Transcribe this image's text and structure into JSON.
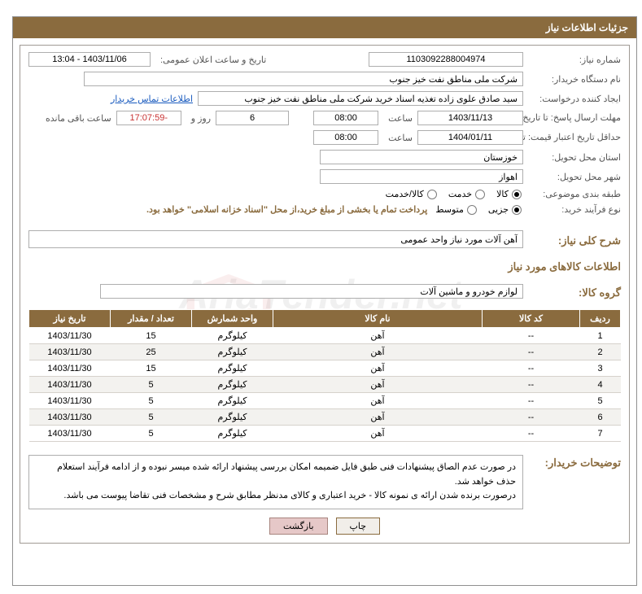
{
  "watermark": "AriaTender.net",
  "header": "جزئیات اطلاعات نیاز",
  "fields": {
    "need_number_label": "شماره نیاز:",
    "need_number": "1103092288004974",
    "announce_datetime_label": "تاریخ و ساعت اعلان عمومی:",
    "announce_datetime": "1403/11/06 - 13:04",
    "buyer_org_label": "نام دستگاه خریدار:",
    "buyer_org": "شرکت ملی مناطق نفت خیز جنوب",
    "requestor_label": "ایجاد کننده درخواست:",
    "requestor": "سید صادق علوی زاده  تغذیه اسناد خرید  شرکت ملی مناطق نفت خیز جنوب",
    "buyer_contact_link": "اطلاعات تماس خریدار",
    "response_deadline_label": "مهلت ارسال پاسخ: تا تاریخ:",
    "response_deadline_date": "1403/11/13",
    "hour_label": "ساعت",
    "response_deadline_time": "08:00",
    "days_remain": "6",
    "days_and": "روز و",
    "time_remain": "17:07:59-",
    "remain_suffix": "ساعت باقی مانده",
    "price_validity_label": "حداقل تاریخ اعتبار قیمت: تا تاریخ:",
    "price_validity_date": "1404/01/11",
    "price_validity_time": "08:00",
    "province_label": "استان محل تحویل:",
    "province": "خوزستان",
    "city_label": "شهر محل تحویل:",
    "city": "اهواز",
    "category_label": "طبقه بندی موضوعی:",
    "cat_goods": "کالا",
    "cat_services": "خدمت",
    "cat_goods_services": "کالا/خدمت",
    "purchase_type_label": "نوع فرآیند خرید:",
    "pt_partial": "جزیی",
    "pt_medium": "متوسط",
    "purchase_note": "پرداخت تمام یا بخشی از مبلغ خرید،از محل \"اسناد خزانه اسلامی\" خواهد بود.",
    "need_summary_label": "شرح کلی نیاز:",
    "need_summary": "آهن آلات مورد نیاز واحد عمومی",
    "items_section": "اطلاعات کالاهای مورد نیاز",
    "group_label": "گروه کالا:",
    "group_value": "لوازم خودرو و ماشین آلات",
    "buyer_notes_label": "توضیحات خریدار:",
    "buyer_notes_1": "در صورت عدم الصاق پیشنهادات فنی طبق فایل ضمیمه امکان بررسی پیشنهاد ارائه شده میسر نبوده و از ادامه فرآیند استعلام حذف خواهد شد.",
    "buyer_notes_2": "درصورت برنده شدن ارائه ی نمونه کالا - خرید اعتباری و کالای مدنظر مطابق شرح و مشخصات فنی تقاضا پیوست می باشد."
  },
  "table": {
    "headers": {
      "row": "ردیف",
      "code": "کد کالا",
      "name": "نام کالا",
      "unit": "واحد شمارش",
      "qty": "تعداد / مقدار",
      "date": "تاریخ نیاز"
    },
    "rows": [
      {
        "row": "1",
        "code": "--",
        "name": "آهن",
        "unit": "کیلوگرم",
        "qty": "15",
        "date": "1403/11/30"
      },
      {
        "row": "2",
        "code": "--",
        "name": "آهن",
        "unit": "کیلوگرم",
        "qty": "25",
        "date": "1403/11/30"
      },
      {
        "row": "3",
        "code": "--",
        "name": "آهن",
        "unit": "کیلوگرم",
        "qty": "15",
        "date": "1403/11/30"
      },
      {
        "row": "4",
        "code": "--",
        "name": "آهن",
        "unit": "کیلوگرم",
        "qty": "5",
        "date": "1403/11/30"
      },
      {
        "row": "5",
        "code": "--",
        "name": "آهن",
        "unit": "کیلوگرم",
        "qty": "5",
        "date": "1403/11/30"
      },
      {
        "row": "6",
        "code": "--",
        "name": "آهن",
        "unit": "کیلوگرم",
        "qty": "5",
        "date": "1403/11/30"
      },
      {
        "row": "7",
        "code": "--",
        "name": "آهن",
        "unit": "کیلوگرم",
        "qty": "5",
        "date": "1403/11/30"
      }
    ]
  },
  "buttons": {
    "print": "چاپ",
    "back": "بازگشت"
  }
}
